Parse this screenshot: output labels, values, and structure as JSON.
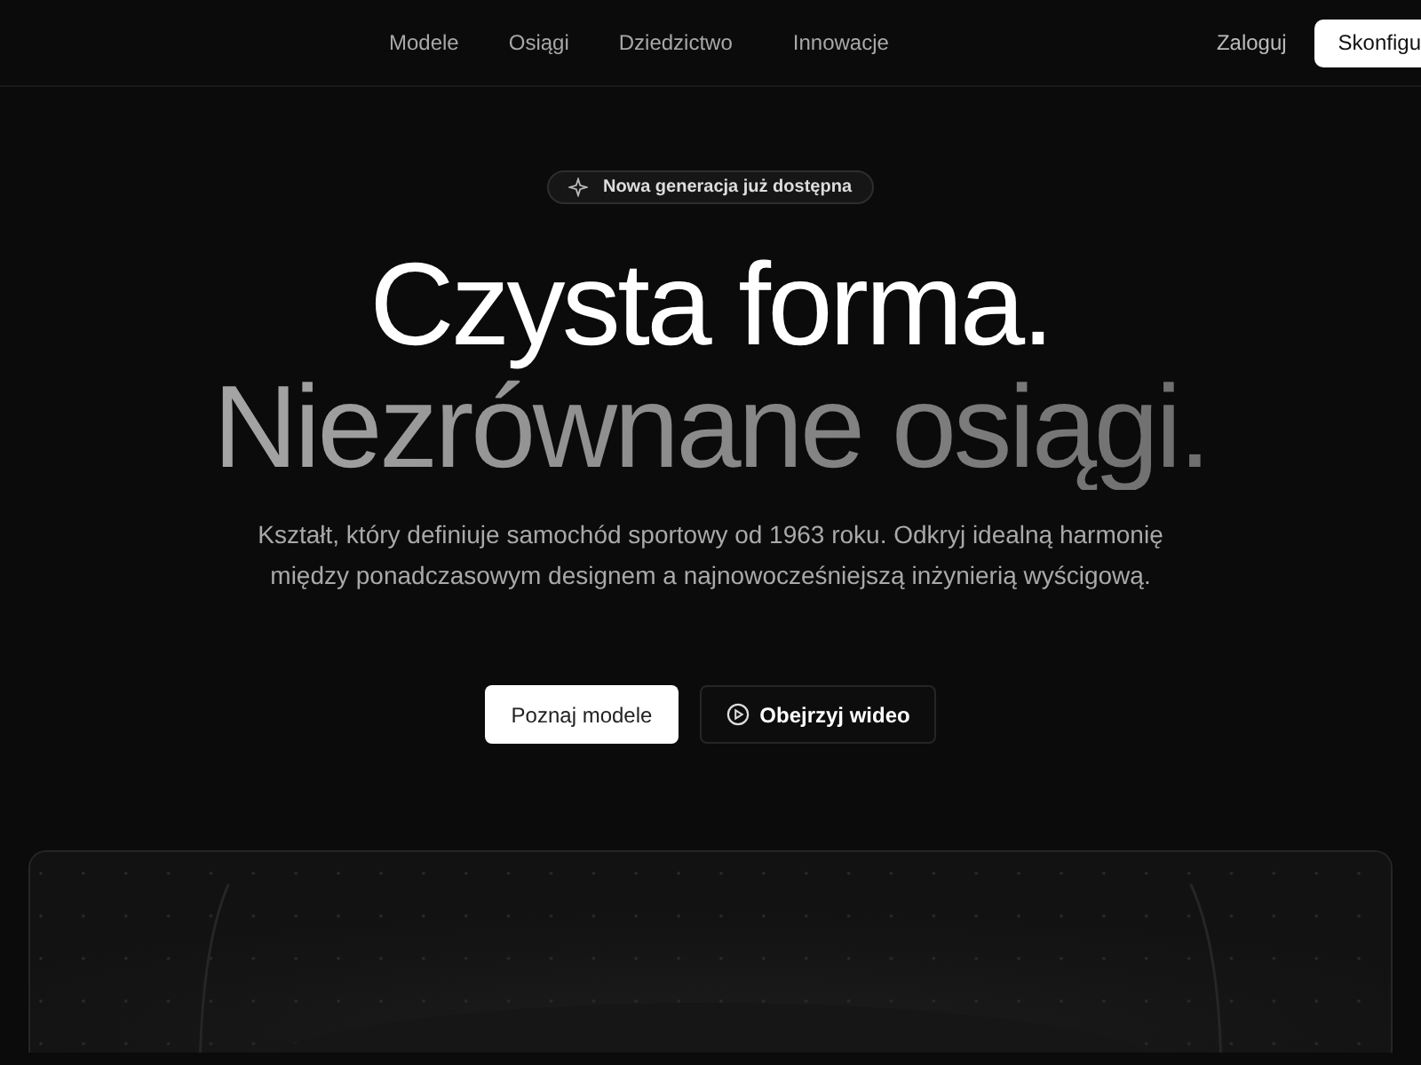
{
  "nav": {
    "links": [
      {
        "label": "Modele"
      },
      {
        "label": "Osiągi"
      },
      {
        "label": "Dziedzictwo"
      },
      {
        "label": "Innowacje"
      }
    ],
    "login": "Zaloguj",
    "cta": "Skonfigu"
  },
  "hero": {
    "badge": "Nowa generacja już dostępna",
    "title_line_1": "Czysta forma.",
    "title_line_2": "Niezrównane osiągi.",
    "lead": "Kształt, który definiuje samochód sportowy od 1963 roku. Odkryj idealną harmonię między ponadczasowym designem a najnowocześniejszą inżynierią wyścigową.",
    "buttons": [
      {
        "kind": "primary",
        "label": "Poznaj modele"
      },
      {
        "kind": "video",
        "label": "Obejrzyj wideo"
      }
    ]
  }
}
